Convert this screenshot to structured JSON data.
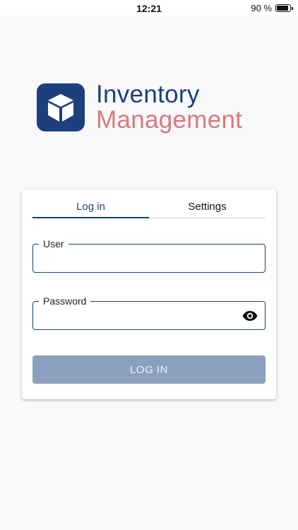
{
  "status_bar": {
    "time": "12:21",
    "battery_text": "90 %",
    "battery_level": 0.9
  },
  "logo": {
    "line1": "Inventory",
    "line2": "Management",
    "icon": "box-icon"
  },
  "tabs": [
    {
      "label": "Log in",
      "active": true
    },
    {
      "label": "Settings",
      "active": false
    }
  ],
  "form": {
    "user_label": "User",
    "user_value": "",
    "password_label": "Password",
    "password_value": "",
    "login_button": "LOG IN"
  },
  "colors": {
    "brand_blue": "#1d3f7c",
    "brand_pink": "#d8797f",
    "button_disabled": "#8ba0be"
  }
}
